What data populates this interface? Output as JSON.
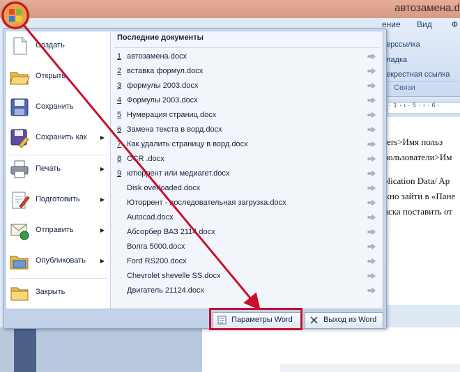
{
  "window": {
    "title": "автозамена.d"
  },
  "ribbon": {
    "tabs": [
      "ение",
      "Вид",
      "Ф"
    ],
    "items": [
      "ерссылка",
      "ладка",
      "екрестная ссылка"
    ],
    "group": "Связи"
  },
  "ruler": {
    "marks": "· 1 · ı · 5 · ı · 6 ·"
  },
  "document": {
    "lines": [
      "sers>Имя польз",
      "пользователи>Им",
      "plication Data/ Ap",
      "жно зайти в «Пане",
      "иска поставить от"
    ]
  },
  "menu": {
    "items": [
      {
        "label": "Создать",
        "icon": "new-document-icon",
        "submenu": false
      },
      {
        "label": "Открыть",
        "icon": "open-folder-icon",
        "submenu": false
      },
      {
        "label": "Сохранить",
        "icon": "save-disk-icon",
        "submenu": false
      },
      {
        "label": "Сохранить как",
        "icon": "save-as-icon",
        "submenu": true
      },
      {
        "label": "Печать",
        "icon": "printer-icon",
        "submenu": true
      },
      {
        "label": "Подготовить",
        "icon": "prepare-document-icon",
        "submenu": true
      },
      {
        "label": "Отправить",
        "icon": "send-icon",
        "submenu": true
      },
      {
        "label": "Опубликовать",
        "icon": "publish-icon",
        "submenu": true
      },
      {
        "label": "Закрыть",
        "icon": "close-folder-icon",
        "submenu": false
      }
    ],
    "recent_title": "Последние документы",
    "recent": [
      {
        "num": "1",
        "name": "автозамена.docx"
      },
      {
        "num": "2",
        "name": "вставка формул.docx"
      },
      {
        "num": "3",
        "name": "формулы 2003.docx"
      },
      {
        "num": "4",
        "name": "Формулы 2003.docx"
      },
      {
        "num": "5",
        "name": "Нумерация страниц.docx"
      },
      {
        "num": "6",
        "name": "Замена текста в ворд.docx"
      },
      {
        "num": "7",
        "name": "Как удалить страницу в ворд.docx"
      },
      {
        "num": "8",
        "name": "OCR .docx"
      },
      {
        "num": "9",
        "name": "ютюррент или медиагет.docx"
      },
      {
        "num": "",
        "name": "Disk overloaded.docx"
      },
      {
        "num": "",
        "name": "Юторрент - последовательная загрузка.docx"
      },
      {
        "num": "",
        "name": "Autocad.docx"
      },
      {
        "num": "",
        "name": "Абсорбер ВАЗ 2114.docx"
      },
      {
        "num": "",
        "name": "Волга 5000.docx"
      },
      {
        "num": "",
        "name": "Ford RS200.docx"
      },
      {
        "num": "",
        "name": "Chevrolet shevelle SS.docx"
      },
      {
        "num": "",
        "name": "Двигатель 21124.docx"
      }
    ],
    "options_label": "Параметры Word",
    "exit_label": "Выход из Word"
  },
  "colors": {
    "annotation": "#c8102e",
    "menu_bg": "#c9d8ec",
    "title_bar": "#d99b86"
  }
}
